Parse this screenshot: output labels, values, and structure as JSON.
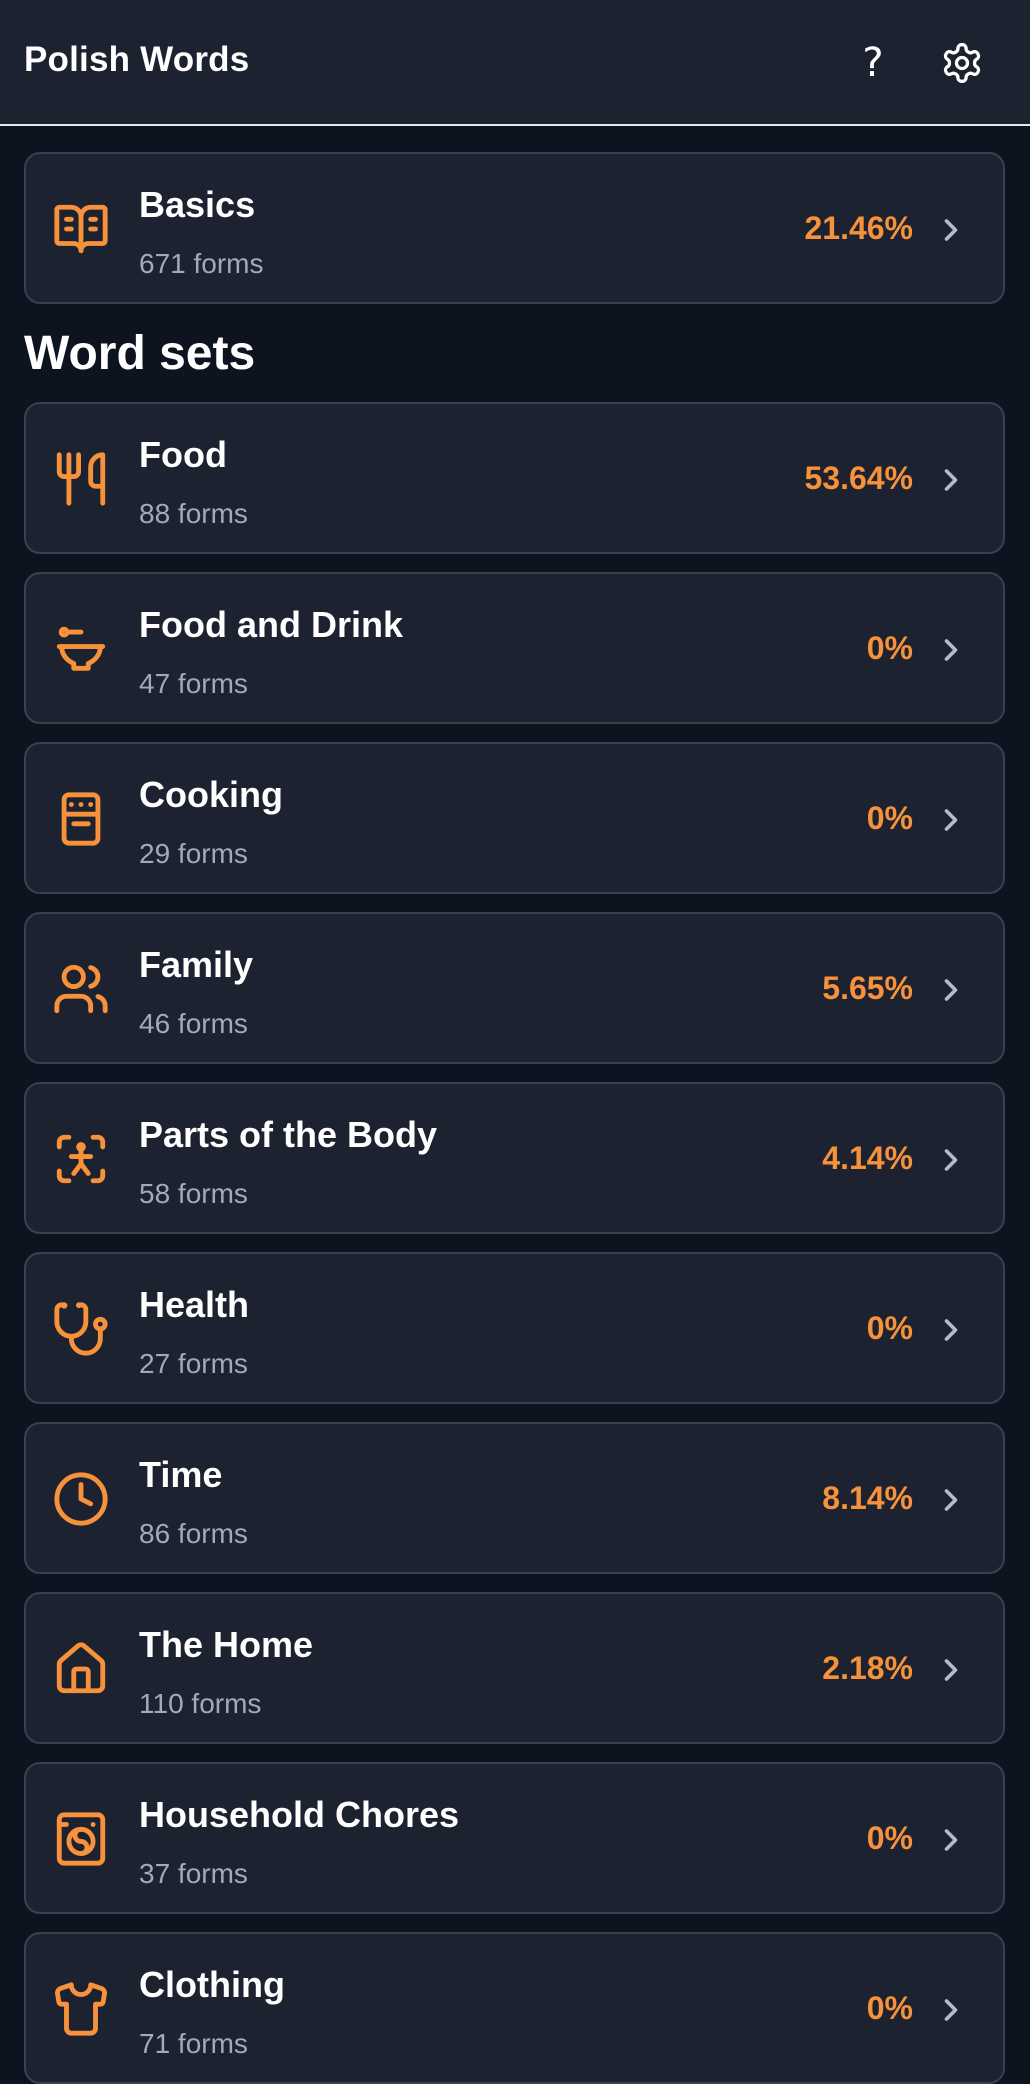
{
  "header": {
    "title": "Polish Words",
    "help_label": "?",
    "help_icon": "help-icon",
    "settings_icon": "gear-icon"
  },
  "accent_color": "#f7923a",
  "basics": {
    "name": "Basics",
    "count": "671 forms",
    "percent": "21.46%",
    "icon": "book-open-icon"
  },
  "section_title": "Word sets",
  "sets": [
    {
      "name": "Food",
      "count": "88 forms",
      "percent": "53.64%",
      "icon": "utensils-icon"
    },
    {
      "name": "Food and Drink",
      "count": "47 forms",
      "percent": "0%",
      "icon": "bowl-icon"
    },
    {
      "name": "Cooking",
      "count": "29 forms",
      "percent": "0%",
      "icon": "oven-icon"
    },
    {
      "name": "Family",
      "count": "46 forms",
      "percent": "5.65%",
      "icon": "users-icon"
    },
    {
      "name": "Parts of the Body",
      "count": "58 forms",
      "percent": "4.14%",
      "icon": "body-scan-icon"
    },
    {
      "name": "Health",
      "count": "27 forms",
      "percent": "0%",
      "icon": "stethoscope-icon"
    },
    {
      "name": "Time",
      "count": "86 forms",
      "percent": "8.14%",
      "icon": "clock-icon"
    },
    {
      "name": "The Home",
      "count": "110 forms",
      "percent": "2.18%",
      "icon": "house-icon"
    },
    {
      "name": "Household Chores",
      "count": "37 forms",
      "percent": "0%",
      "icon": "washing-machine-icon"
    },
    {
      "name": "Clothing",
      "count": "71 forms",
      "percent": "0%",
      "icon": "shirt-icon"
    }
  ]
}
